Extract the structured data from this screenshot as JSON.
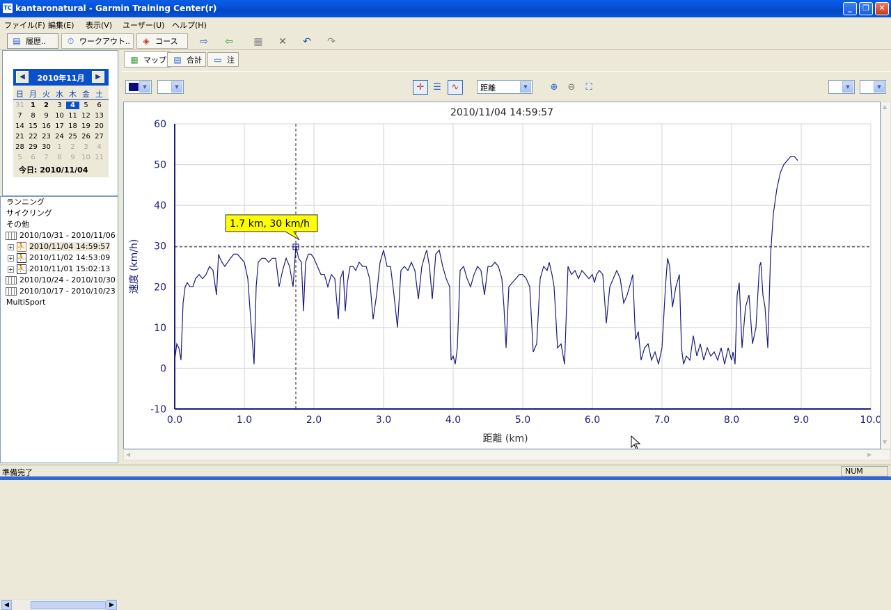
{
  "window": {
    "title": "kantaronatural - Garmin Training Center(r)",
    "app_icon_label": "TC",
    "minimize": "_",
    "maximize": "❐",
    "close": "✕"
  },
  "menu": [
    "ファイル(F)",
    "編集(E)",
    "表示(V)",
    "ユーザー(U)",
    "ヘルプ(H)"
  ],
  "toolbar": {
    "history_label": "履歴..",
    "workout_label": "ワークアウト..",
    "course_label": "コース"
  },
  "calendar": {
    "month_title": "2010年11月",
    "prev": "◀",
    "next": "▶",
    "weekdays": [
      "日",
      "月",
      "火",
      "水",
      "木",
      "金",
      "土"
    ],
    "weeks": [
      [
        "31",
        "1",
        "2",
        "3",
        "4",
        "5",
        "6"
      ],
      [
        "7",
        "8",
        "9",
        "10",
        "11",
        "12",
        "13"
      ],
      [
        "14",
        "15",
        "16",
        "17",
        "18",
        "19",
        "20"
      ],
      [
        "21",
        "22",
        "23",
        "24",
        "25",
        "26",
        "27"
      ],
      [
        "28",
        "29",
        "30",
        "1",
        "2",
        "3",
        "4"
      ],
      [
        "5",
        "6",
        "7",
        "8",
        "9",
        "10",
        "11"
      ]
    ],
    "today_label": "今日: 2010/11/04"
  },
  "tree": {
    "categories": [
      "ランニング",
      "サイクリング",
      "その他"
    ],
    "week1": "2010/10/31 - 2010/11/06",
    "activities": [
      "2010/11/04 14:59:57",
      "2010/11/02 14:53:09",
      "2010/11/01 15:02:13"
    ],
    "week2": "2010/10/24 - 2010/10/30",
    "week3": "2010/10/17 - 2010/10/23",
    "multisport": "MultiSport"
  },
  "tabs": [
    "マップ",
    "合計",
    "注"
  ],
  "chart_toolbar": {
    "x_axis_select": "距離"
  },
  "chart_data": {
    "type": "line",
    "title": "2010/11/04 14:59:57",
    "xlabel": "距離 (km)",
    "ylabel": "速度 (km/h)",
    "xlim": [
      0.0,
      10.0
    ],
    "ylim": [
      -10,
      60
    ],
    "x_ticks": [
      "0.0",
      "1.0",
      "2.0",
      "3.0",
      "4.0",
      "5.0",
      "6.0",
      "7.0",
      "8.0",
      "9.0",
      "10.0"
    ],
    "y_ticks": [
      "-10",
      "0",
      "10",
      "20",
      "30",
      "40",
      "50",
      "60"
    ],
    "grid": true,
    "line_color": "#1a1a80",
    "tooltip": {
      "text": "1.7 km, 30 km/h",
      "x": 1.74,
      "y": 29.8
    },
    "x": [
      0.0,
      0.03,
      0.06,
      0.09,
      0.12,
      0.15,
      0.18,
      0.22,
      0.26,
      0.3,
      0.35,
      0.4,
      0.45,
      0.5,
      0.55,
      0.6,
      0.63,
      0.65,
      0.68,
      0.72,
      0.76,
      0.8,
      0.85,
      0.9,
      0.95,
      1.0,
      1.05,
      1.1,
      1.14,
      1.17,
      1.2,
      1.25,
      1.3,
      1.35,
      1.4,
      1.45,
      1.5,
      1.55,
      1.6,
      1.65,
      1.7,
      1.74,
      1.78,
      1.82,
      1.85,
      1.88,
      1.92,
      1.96,
      2.0,
      2.05,
      2.1,
      2.15,
      2.2,
      2.25,
      2.3,
      2.35,
      2.38,
      2.42,
      2.45,
      2.48,
      2.52,
      2.56,
      2.6,
      2.65,
      2.7,
      2.75,
      2.8,
      2.85,
      2.9,
      2.95,
      3.0,
      3.05,
      3.1,
      3.15,
      3.2,
      3.25,
      3.3,
      3.35,
      3.4,
      3.45,
      3.5,
      3.55,
      3.6,
      3.62,
      3.66,
      3.7,
      3.75,
      3.8,
      3.85,
      3.9,
      3.95,
      3.97,
      4.0,
      4.03,
      4.06,
      4.1,
      4.15,
      4.2,
      4.25,
      4.3,
      4.35,
      4.4,
      4.45,
      4.5,
      4.55,
      4.6,
      4.65,
      4.7,
      4.73,
      4.76,
      4.8,
      4.85,
      4.9,
      4.95,
      5.0,
      5.05,
      5.1,
      5.15,
      5.2,
      5.25,
      5.3,
      5.35,
      5.38,
      5.42,
      5.45,
      5.5,
      5.55,
      5.6,
      5.65,
      5.7,
      5.75,
      5.8,
      5.85,
      5.9,
      5.95,
      6.0,
      6.03,
      6.06,
      6.1,
      6.15,
      6.2,
      6.25,
      6.3,
      6.35,
      6.4,
      6.45,
      6.5,
      6.55,
      6.58,
      6.62,
      6.66,
      6.7,
      6.75,
      6.8,
      6.85,
      6.9,
      6.95,
      7.0,
      7.05,
      7.08,
      7.11,
      7.15,
      7.2,
      7.25,
      7.28,
      7.31,
      7.35,
      7.4,
      7.45,
      7.5,
      7.55,
      7.6,
      7.65,
      7.7,
      7.75,
      7.8,
      7.85,
      7.9,
      7.95,
      8.0,
      8.02,
      8.05,
      8.08,
      8.11,
      8.15,
      8.2,
      8.25,
      8.3,
      8.35,
      8.4,
      8.42,
      8.45,
      8.48,
      8.52,
      8.56,
      8.6,
      8.65,
      8.7,
      8.75,
      8.8,
      8.85,
      8.9,
      8.95,
      9.0,
      9.05,
      9.1,
      9.15,
      9.2
    ],
    "y": [
      2,
      6,
      5,
      2,
      16,
      20,
      21,
      20,
      20,
      22,
      23,
      22,
      23,
      25,
      24,
      18,
      28,
      27,
      26,
      25,
      26,
      27,
      28,
      28,
      27,
      26,
      22,
      10,
      1,
      20,
      26,
      27,
      27,
      26,
      27,
      27,
      20,
      24,
      27,
      25,
      20,
      30,
      27,
      26,
      14,
      26,
      28,
      28,
      27,
      25,
      23,
      23,
      20,
      23,
      22,
      12,
      22,
      24,
      14,
      21,
      25,
      25,
      24,
      26,
      25,
      25,
      22,
      12,
      18,
      26,
      29,
      25,
      25,
      18,
      10,
      24,
      25,
      24,
      26,
      24,
      17,
      25,
      28,
      29,
      25,
      17,
      28,
      29,
      25,
      22,
      20,
      2,
      3,
      1,
      5,
      24,
      25,
      22,
      20,
      23,
      25,
      24,
      18,
      25,
      25,
      26,
      25,
      22,
      15,
      5,
      20,
      21,
      22,
      23,
      23,
      22,
      20,
      4,
      6,
      22,
      25,
      24,
      26,
      23,
      20,
      5,
      6,
      1,
      25,
      23,
      24,
      22,
      24,
      23,
      22,
      23,
      21,
      23,
      24,
      23,
      11,
      20,
      22,
      24,
      22,
      16,
      18,
      21,
      23,
      7,
      9,
      2,
      5,
      6,
      2,
      4,
      1,
      5,
      20,
      27,
      25,
      15,
      20,
      23,
      5,
      1,
      3,
      2,
      8,
      3,
      6,
      2,
      5,
      3,
      4,
      2,
      5,
      1,
      5,
      2,
      4,
      1,
      18,
      21,
      5,
      15,
      18,
      6,
      10,
      25,
      26,
      18,
      15,
      5,
      28,
      38,
      44,
      48,
      50,
      51,
      52,
      52,
      51
    ],
    "crosshair": {
      "x": 1.74,
      "y": 29.8
    }
  },
  "status": {
    "message": "準備完了",
    "num": "NUM"
  }
}
